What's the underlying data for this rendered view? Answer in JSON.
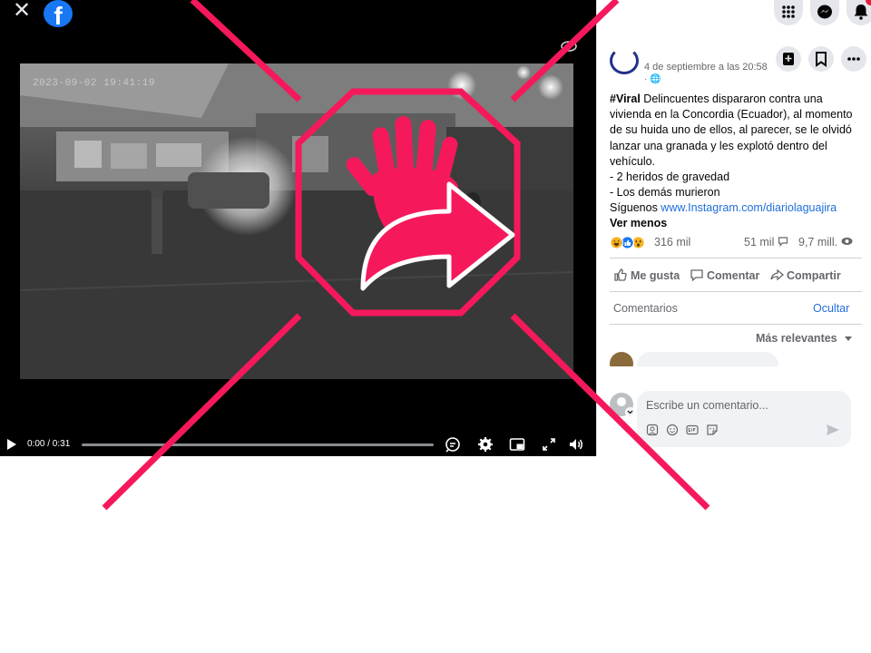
{
  "viewer": {
    "close_glyph": "✕",
    "logo_letter": "f",
    "overlay_timestamp": "2023-09-02 19:41:19",
    "colors": {
      "background": "#000000",
      "facebook_blue": "#1877f2"
    }
  },
  "video_controls": {
    "time": "0:00 / 0:31",
    "progress": 0,
    "icons": [
      "play-icon",
      "captions-icon",
      "settings-icon",
      "picture-in-picture-icon",
      "fullscreen-icon",
      "volume-icon"
    ]
  },
  "header_icons": [
    "apps-grid-icon",
    "messenger-icon",
    "notifications-icon"
  ],
  "post": {
    "date": "4 de septiembre a las 20:58",
    "privacy": "· 🌐",
    "text": {
      "hashtag": "#Viral",
      "lines": [
        " Delincuentes dispararon contra una",
        "vivienda en la Concordia (Ecuador), al momento",
        "de su huida uno de ellos, al parecer, se le olvidó",
        "lanzar una granada y les explotó dentro del",
        "vehículo.",
        "- 2 heridos de gravedad",
        "- Los demás murieron"
      ],
      "follow_prefix": "Síguenos ",
      "follow_link": "www.Instagram.com/diariolaguajira",
      "see_less": "Ver menos"
    },
    "stats": {
      "reactions": "316 mil",
      "comments": "51 mil",
      "views": "9,7 mill."
    },
    "actions": {
      "like": "Me gusta",
      "comment": "Comentar",
      "share": "Compartir"
    },
    "colors": {
      "link": "#216fdb",
      "secondary_text": "#65676b"
    }
  },
  "comments": {
    "heading": "Comentarios",
    "hide": "Ocultar",
    "sort": "Más relevantes",
    "input_placeholder": "Escribe un comentario..."
  },
  "overlay": {
    "meaning": "stop-sharing-sign",
    "color": "#f5195c"
  }
}
